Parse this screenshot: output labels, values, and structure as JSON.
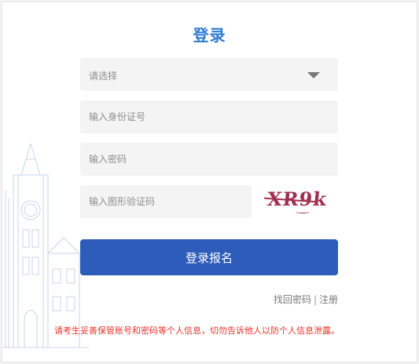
{
  "form": {
    "title": "登录",
    "select": {
      "placeholder": "请选择"
    },
    "id_number": {
      "placeholder": "输入身份证号"
    },
    "password": {
      "placeholder": "输入密码"
    },
    "captcha": {
      "placeholder": "输入图形验证码",
      "image_text": "XR9k"
    },
    "submit_label": "登录报名",
    "forgot_password": "找回密码",
    "separator": "|",
    "register": "注册"
  },
  "notice": "请考生妥善保管账号和密码等个人信息，切勿告诉他人以防个人信息泄露。",
  "colors": {
    "title": "#2e7bd1",
    "button": "#2d5cba",
    "notice": "#e8332b",
    "captcha": "#a03050"
  }
}
